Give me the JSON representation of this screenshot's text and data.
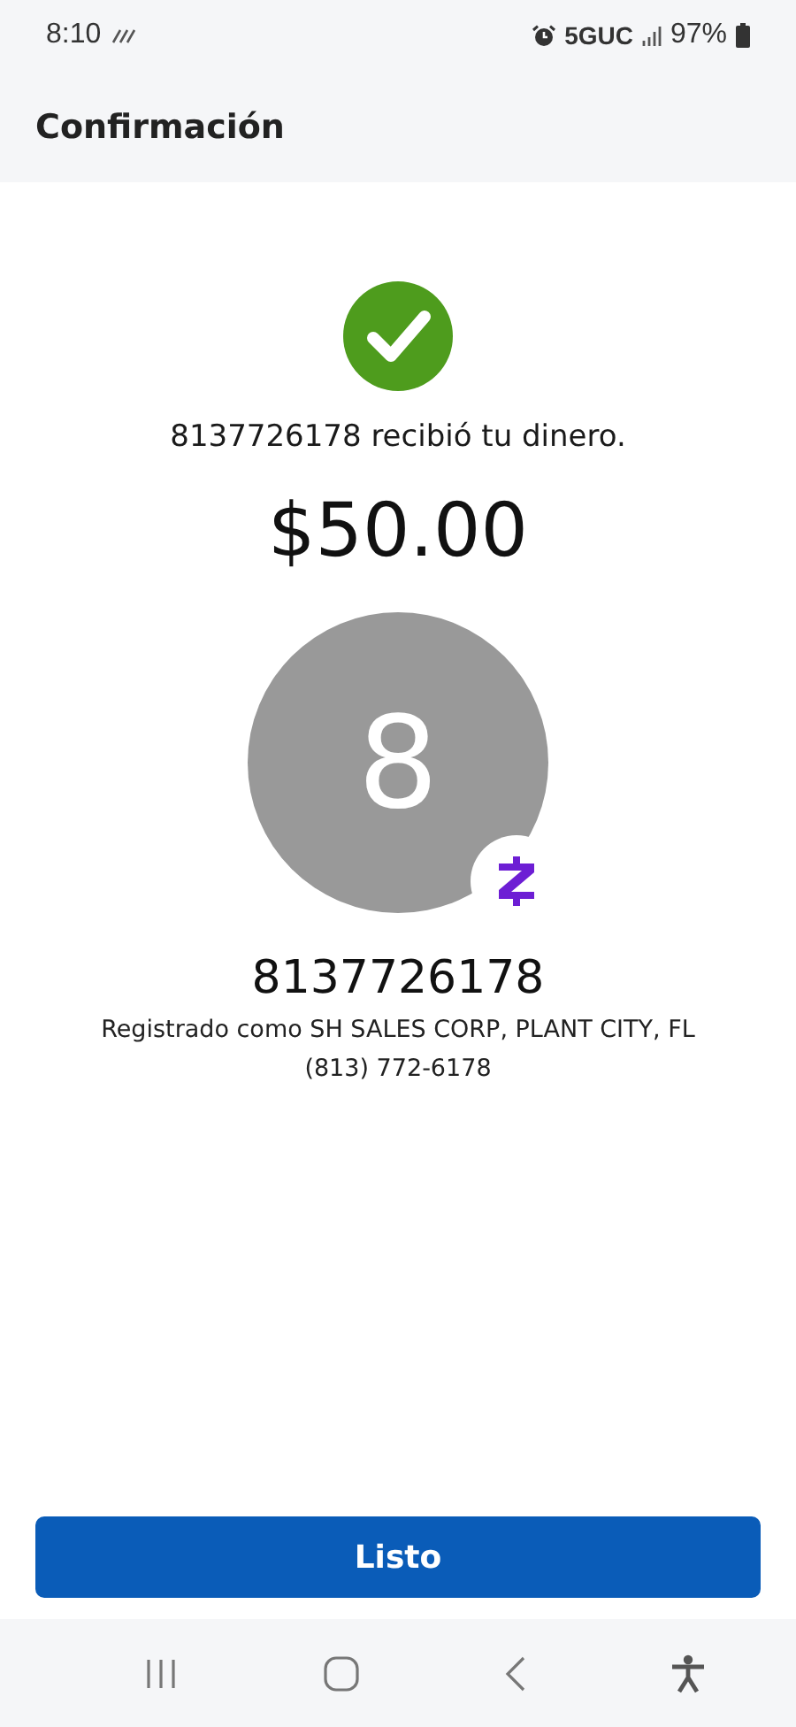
{
  "status_bar": {
    "time": "8:10",
    "network": "5GUC",
    "battery": "97%"
  },
  "header": {
    "title": "Confirmación"
  },
  "confirmation": {
    "message": "8137726178 recibió tu dinero.",
    "amount": "$50.00"
  },
  "recipient": {
    "initial": "8",
    "name": "8137726178",
    "registered": "Registrado como SH SALES CORP, PLANT CITY, FL",
    "phone": "(813) 772-6178"
  },
  "done_button": {
    "label": "Listo"
  }
}
